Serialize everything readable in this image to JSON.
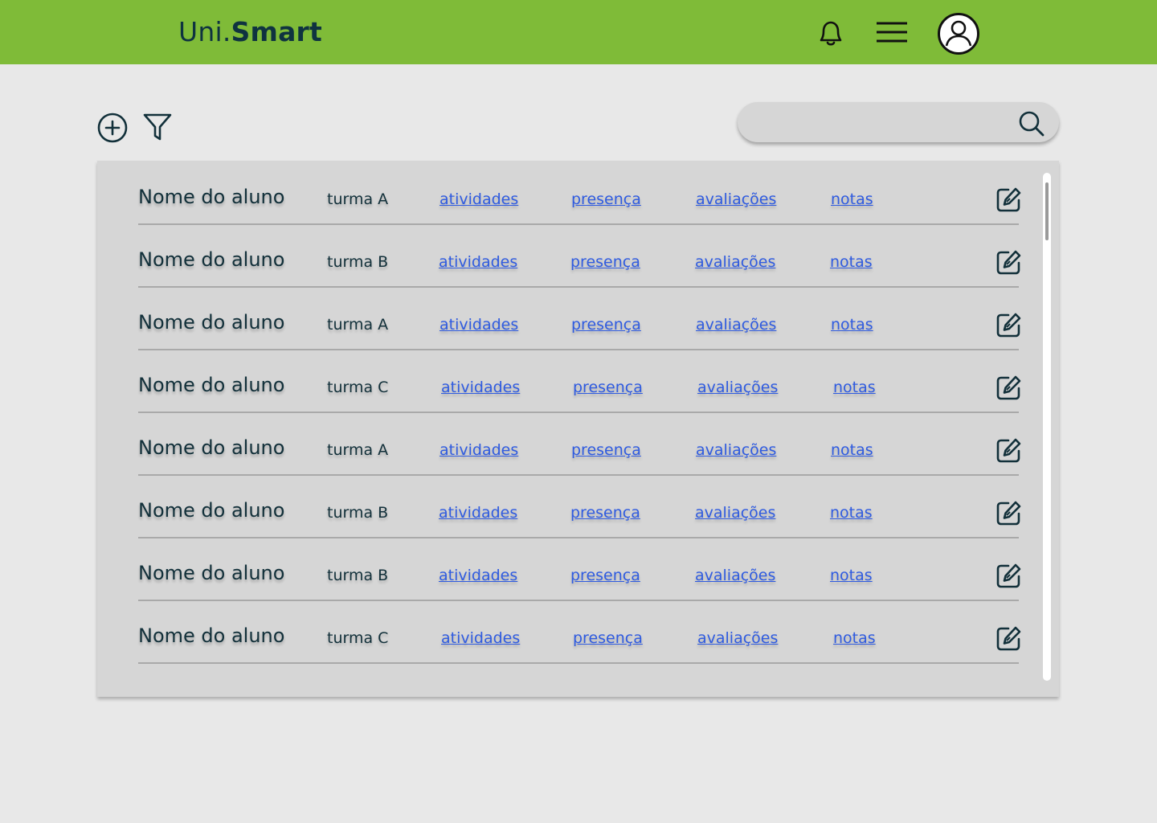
{
  "header": {
    "logo_light": "Uni.",
    "logo_bold": "Smart",
    "brand_color": "#7fbb38",
    "icons": [
      "bell-icon",
      "menu-icon",
      "user-icon"
    ]
  },
  "toolbar": {
    "icons": [
      "plus-circle-icon",
      "filter-icon"
    ],
    "search_value": "",
    "search_icon": "search-icon"
  },
  "students": [
    {
      "name": "Nome do aluno",
      "turma": "turma A",
      "atividades": "atividades",
      "presenca": "presença",
      "avaliacoes": "avaliações",
      "notas": "notas"
    },
    {
      "name": "Nome do aluno",
      "turma": "turma B",
      "atividades": "atividades",
      "presenca": "presença",
      "avaliacoes": "avaliações",
      "notas": "notas"
    },
    {
      "name": "Nome do aluno",
      "turma": "turma A",
      "atividades": "atividades",
      "presenca": "presença",
      "avaliacoes": "avaliações",
      "notas": "notas"
    },
    {
      "name": "Nome do aluno",
      "turma": "turma C",
      "atividades": "atividades",
      "presenca": "presença",
      "avaliacoes": "avaliações",
      "notas": "notas"
    },
    {
      "name": "Nome do aluno",
      "turma": "turma A",
      "atividades": "atividades",
      "presenca": "presença",
      "avaliacoes": "avaliações",
      "notas": "notas"
    },
    {
      "name": "Nome do aluno",
      "turma": "turma B",
      "atividades": "atividades",
      "presenca": "presença",
      "avaliacoes": "avaliações",
      "notas": "notas"
    },
    {
      "name": "Nome do aluno",
      "turma": "turma B",
      "atividades": "atividades",
      "presenca": "presença",
      "avaliacoes": "avaliações",
      "notas": "notas"
    },
    {
      "name": "Nome do aluno",
      "turma": "turma C",
      "atividades": "atividades",
      "presenca": "presença",
      "avaliacoes": "avaliações",
      "notas": "notas"
    }
  ],
  "link_color": "#2f5be0"
}
